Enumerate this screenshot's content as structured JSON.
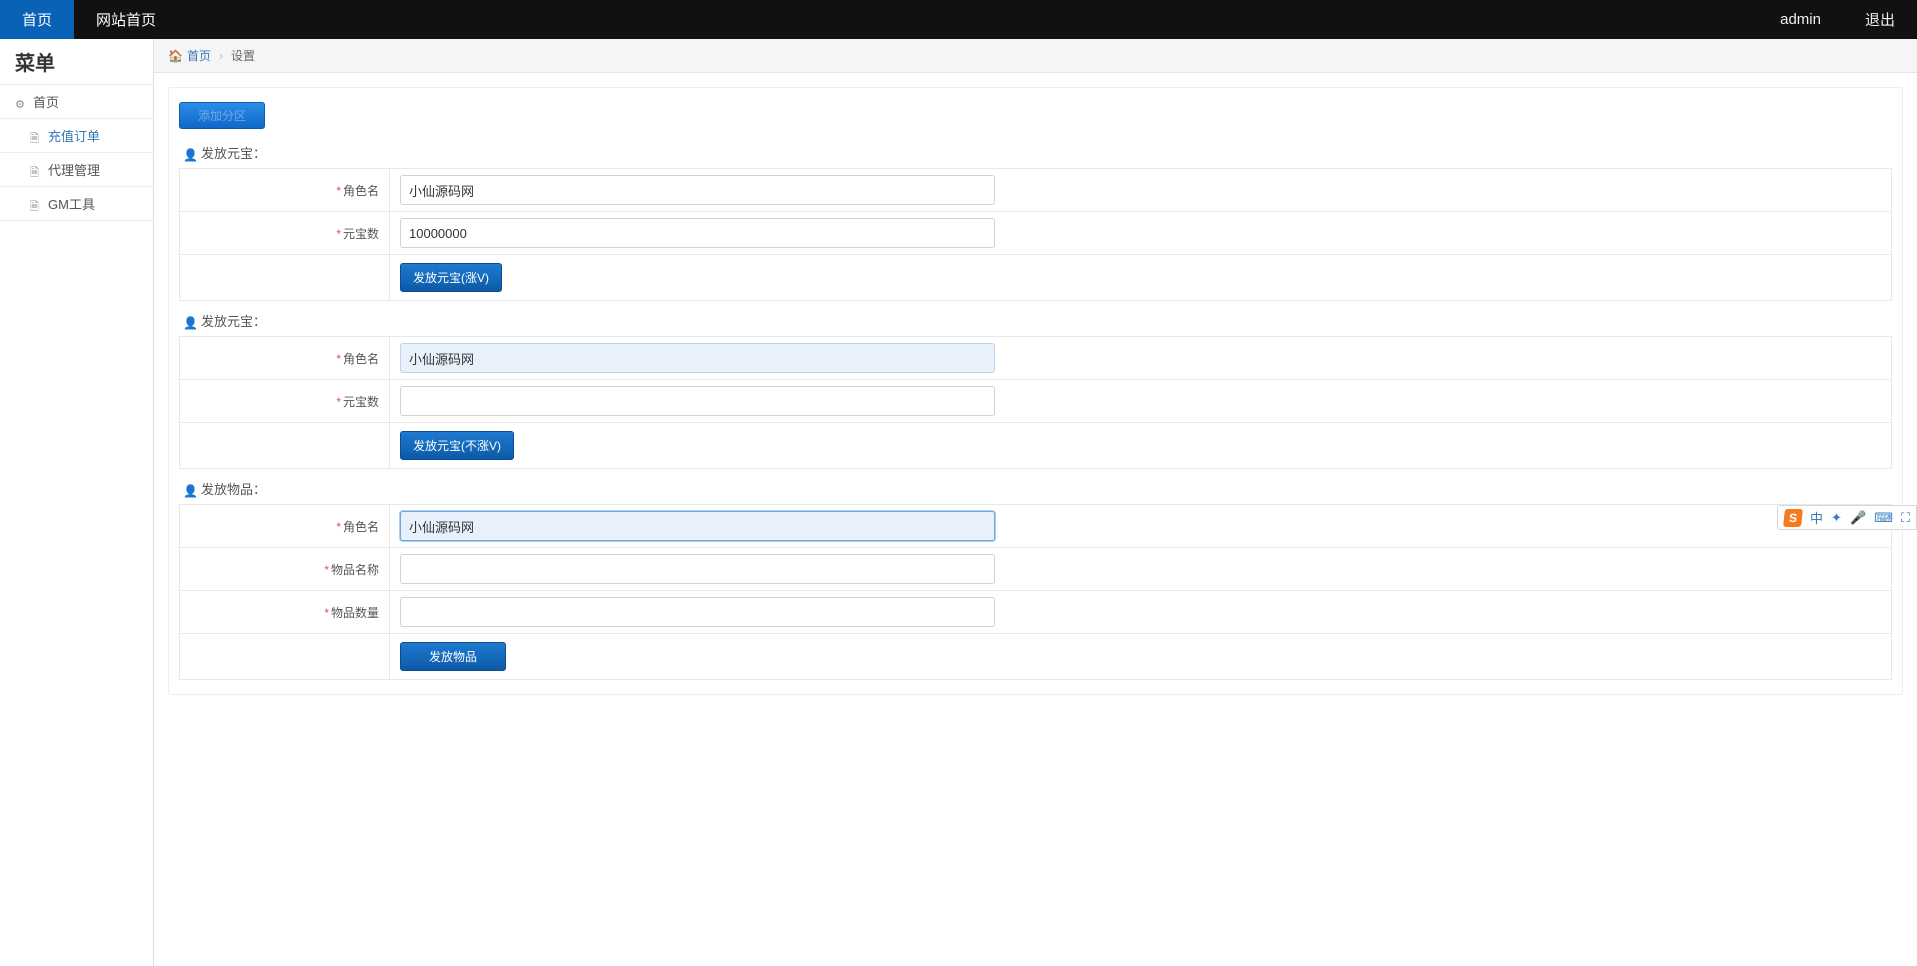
{
  "topnav": {
    "tabs": [
      {
        "label": "首页",
        "active": true
      },
      {
        "label": "网站首页",
        "active": false
      }
    ],
    "user": "admin",
    "logout": "退出"
  },
  "sidebar": {
    "title": "菜单",
    "items": [
      {
        "label": "首页",
        "icon": "gear",
        "active": false,
        "sub": false
      },
      {
        "label": "充值订单",
        "icon": "file",
        "active": true,
        "sub": true
      },
      {
        "label": "代理管理",
        "icon": "file",
        "active": false,
        "sub": true
      },
      {
        "label": "GM工具",
        "icon": "file",
        "active": false,
        "sub": true
      }
    ]
  },
  "breadcrumb": {
    "home_label": "首页",
    "current": "设置"
  },
  "add_zone_btn": "添加分区",
  "sections": [
    {
      "title": "发放元宝：",
      "rows": [
        {
          "label": "角色名",
          "value": "小仙源码网",
          "hl": false
        },
        {
          "label": "元宝数",
          "value": "10000000",
          "hl": false
        }
      ],
      "button": "发放元宝(涨V)"
    },
    {
      "title": "发放元宝：",
      "rows": [
        {
          "label": "角色名",
          "value": "小仙源码网",
          "hl": true
        },
        {
          "label": "元宝数",
          "value": "",
          "hl": false
        }
      ],
      "button": "发放元宝(不涨V)"
    },
    {
      "title": "发放物品：",
      "rows": [
        {
          "label": "角色名",
          "value": "小仙源码网",
          "hl": true,
          "focus": true
        },
        {
          "label": "物品名称",
          "value": "",
          "hl": false
        },
        {
          "label": "物品数量",
          "value": "",
          "hl": false
        }
      ],
      "button": "发放物品",
      "button_wide": true
    }
  ],
  "ime": {
    "logo": "S",
    "items": [
      "中",
      "✦",
      "🎤",
      "⌨",
      "⛶"
    ]
  }
}
